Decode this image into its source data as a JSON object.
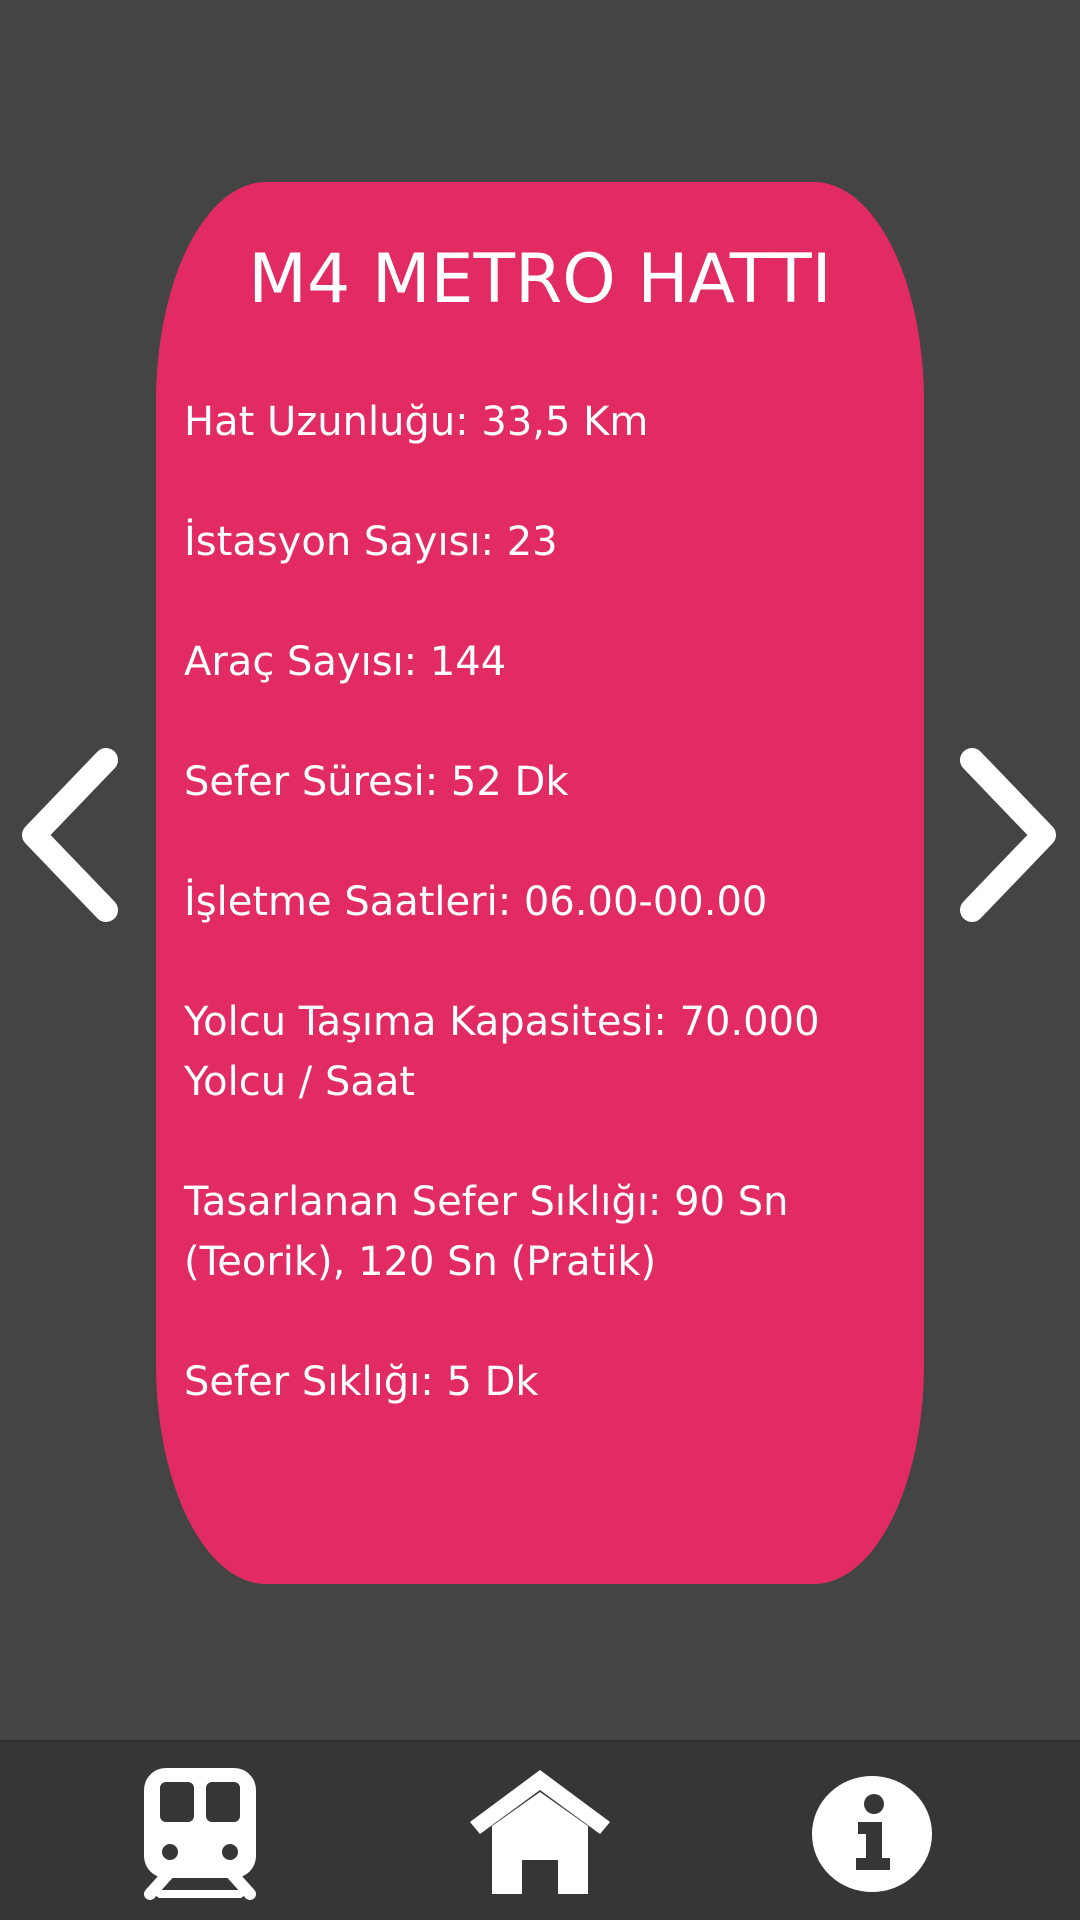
{
  "line": {
    "title": "M4 METRO HATTI",
    "details": [
      "Hat Uzunluğu: 33,5 Km",
      "İstasyon Sayısı: 23",
      "Araç Sayısı: 144",
      "Sefer Süresi: 52 Dk",
      "İşletme Saatleri: 06.00-00.00",
      "Yolcu Taşıma Kapasitesi: 70.000 Yolcu / Saat",
      "Tasarlanan Sefer Sıklığı: 90 Sn (Teorik), 120 Sn (Pratik)",
      "Sefer Sıklığı: 5 Dk"
    ]
  },
  "navigation": {
    "prev_icon": "chevron-left-icon",
    "next_icon": "chevron-right-icon"
  },
  "bottom_nav": {
    "items": [
      {
        "icon": "train-icon"
      },
      {
        "icon": "home-icon"
      },
      {
        "icon": "info-icon"
      }
    ]
  },
  "colors": {
    "background": "#444444",
    "card": "#E22B63",
    "bottom_bar": "#363636",
    "text": "#FFFFFF"
  }
}
